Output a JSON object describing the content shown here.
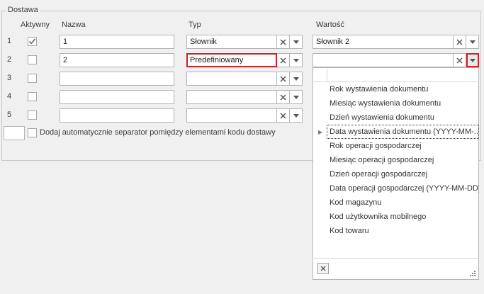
{
  "group": {
    "title": "Dostawa"
  },
  "headers": {
    "active": "Aktywny",
    "name": "Nazwa",
    "type": "Typ",
    "value": "Wartość"
  },
  "rows": [
    {
      "num": "1",
      "checked": true,
      "name": "1",
      "type": "Słownik",
      "value": "Słownik 2"
    },
    {
      "num": "2",
      "checked": false,
      "name": "2",
      "type": "Predefiniowany",
      "value": ""
    },
    {
      "num": "3",
      "checked": false,
      "name": "",
      "type": "",
      "value": ""
    },
    {
      "num": "4",
      "checked": false,
      "name": "",
      "type": "",
      "value": ""
    },
    {
      "num": "5",
      "checked": false,
      "name": "",
      "type": "",
      "value": ""
    }
  ],
  "separator": {
    "label": "Dodaj automatycznie separator pomiędzy elementami kodu dostawy",
    "checked": false
  },
  "dropdown": {
    "items": [
      "Rok wystawienia dokumentu",
      "Miesiąc wystawienia dokumentu",
      "Dzień wystawienia dokumentu",
      "Data wystawienia dokumentu (YYYY-MM-...",
      "Rok operacji gospodarczej",
      "Miesiąc operacji gospodarczej",
      "Dzień operacji gospodarczej",
      "Data operacji gospodarczej (YYYY-MM-DD)",
      "Kod magazynu",
      "Kod użytkownika mobilnego",
      "Kod towaru"
    ],
    "current_index": 3
  },
  "icons": {
    "clear": "close-icon",
    "dropdown": "chevron-down-icon",
    "check": "checkmark-icon",
    "row_indicator": "triangle-right-icon",
    "resize": "resize-grip-icon"
  },
  "colors": {
    "focus": "#d0202a",
    "background": "#f0f0f0"
  }
}
